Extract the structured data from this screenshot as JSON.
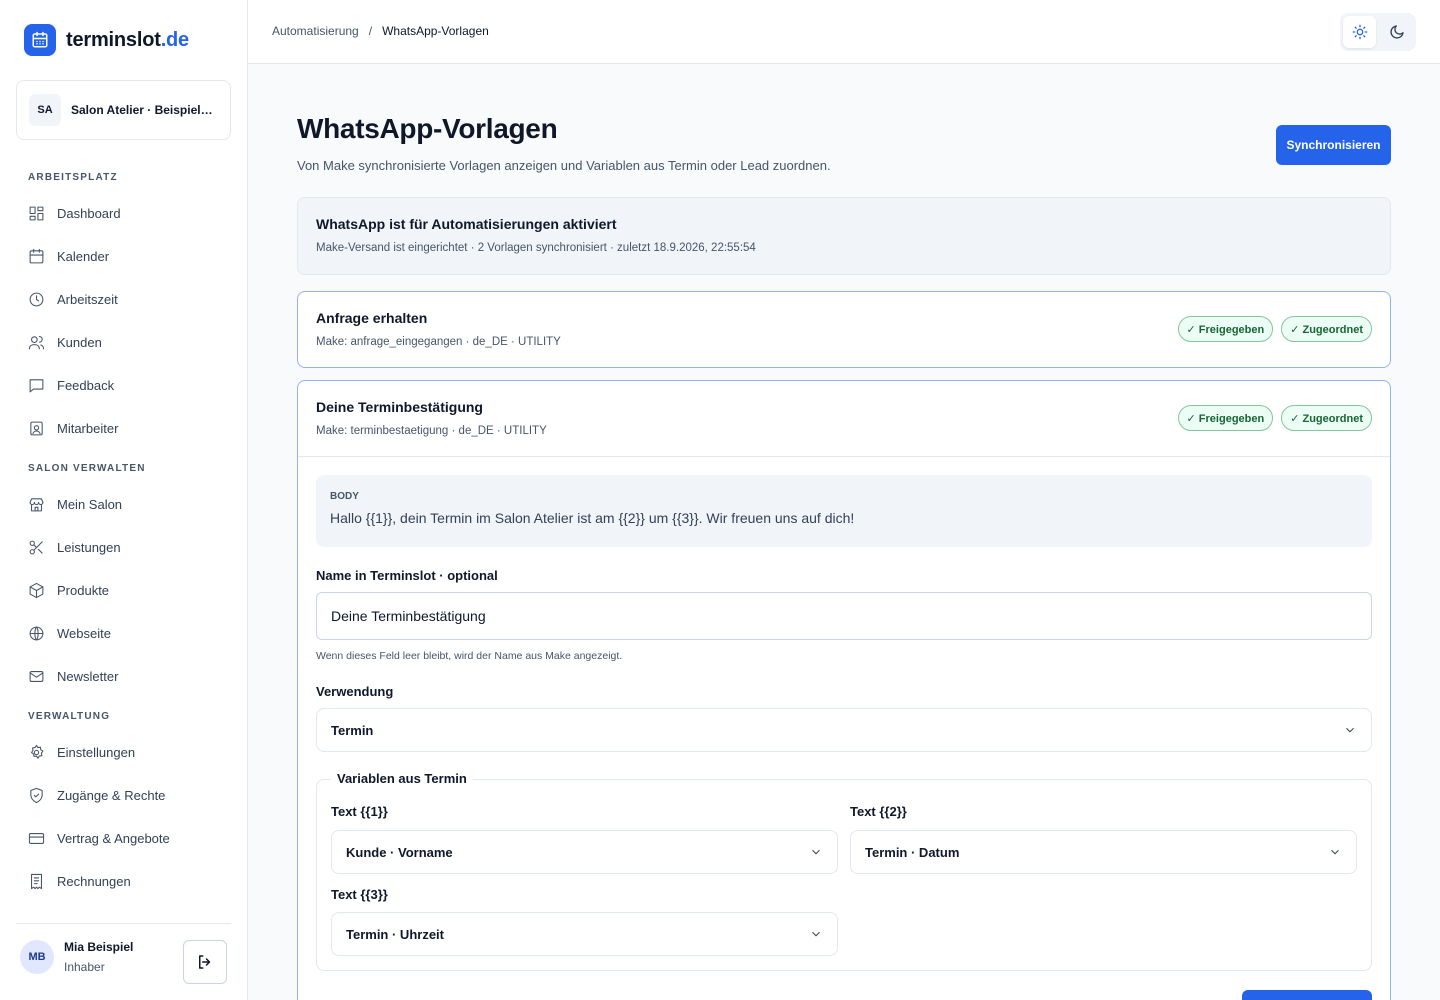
{
  "brand": {
    "name": "terminslot",
    "tld": ".de"
  },
  "salon": {
    "initials": "SA",
    "name": "Salon Atelier · Beispiel…"
  },
  "nav": {
    "section_workspace": "ARBEITSPLATZ",
    "workspace": [
      {
        "label": "Dashboard",
        "icon": "dashboard-icon"
      },
      {
        "label": "Kalender",
        "icon": "calendar-icon"
      },
      {
        "label": "Arbeitszeit",
        "icon": "clock-icon"
      },
      {
        "label": "Kunden",
        "icon": "users-icon"
      },
      {
        "label": "Feedback",
        "icon": "message-icon"
      },
      {
        "label": "Mitarbeiter",
        "icon": "badge-icon"
      }
    ],
    "section_salon": "SALON VERWALTEN",
    "salon": [
      {
        "label": "Mein Salon",
        "icon": "store-icon"
      },
      {
        "label": "Leistungen",
        "icon": "scissors-icon"
      },
      {
        "label": "Produkte",
        "icon": "box-icon"
      },
      {
        "label": "Webseite",
        "icon": "globe-icon"
      },
      {
        "label": "Newsletter",
        "icon": "mail-icon"
      }
    ],
    "section_admin": "VERWALTUNG",
    "admin": [
      {
        "label": "Einstellungen",
        "icon": "gear-icon"
      },
      {
        "label": "Zugänge & Rechte",
        "icon": "shield-icon"
      },
      {
        "label": "Vertrag & Angebote",
        "icon": "card-icon"
      },
      {
        "label": "Rechnungen",
        "icon": "receipt-icon"
      }
    ]
  },
  "user": {
    "initials": "MB",
    "name": "Mia Beispiel",
    "role": "Inhaber"
  },
  "breadcrumb": {
    "parent": "Automatisierung",
    "sep": "/",
    "current": "WhatsApp-Vorlagen"
  },
  "page": {
    "title": "WhatsApp-Vorlagen",
    "subtitle": "Von Make synchronisierte Vorlagen anzeigen und Variablen aus Termin oder Lead zuordnen.",
    "sync_label": "Synchronisieren"
  },
  "status": {
    "title": "WhatsApp ist für Automatisierungen aktiviert",
    "sub": "Make-Versand ist eingerichtet · 2 Vorlagen synchronisiert · zuletzt 18.9.2026, 22:55:54"
  },
  "templates": [
    {
      "title": "Anfrage erhalten",
      "meta": "Make: anfrage_eingegangen · de_DE · UTILITY",
      "badge_approved": "✓ Freigegeben",
      "badge_assigned": "✓ Zugeordnet"
    },
    {
      "title": "Deine Terminbestätigung",
      "meta": "Make: terminbestaetigung · de_DE · UTILITY",
      "badge_approved": "✓ Freigegeben",
      "badge_assigned": "✓ Zugeordnet",
      "body_label": "BODY",
      "body_text": "Hallo {{1}}, dein Termin im Salon Atelier ist am {{2}} um {{3}}. Wir freuen uns auf dich!",
      "name_label": "Name in Terminslot · optional",
      "name_value": "Deine Terminbestätigung",
      "name_hint": "Wenn dieses Feld leer bleibt, wird der Name aus Make angezeigt.",
      "usage_label": "Verwendung",
      "usage_value": "Termin",
      "vars_legend": "Variablen aus Termin",
      "vars": [
        {
          "label": "Text {{1}}",
          "value": "Kunde · Vorname"
        },
        {
          "label": "Text {{2}}",
          "value": "Termin · Datum"
        },
        {
          "label": "Text {{3}}",
          "value": "Termin · Uhrzeit"
        }
      ]
    }
  ]
}
